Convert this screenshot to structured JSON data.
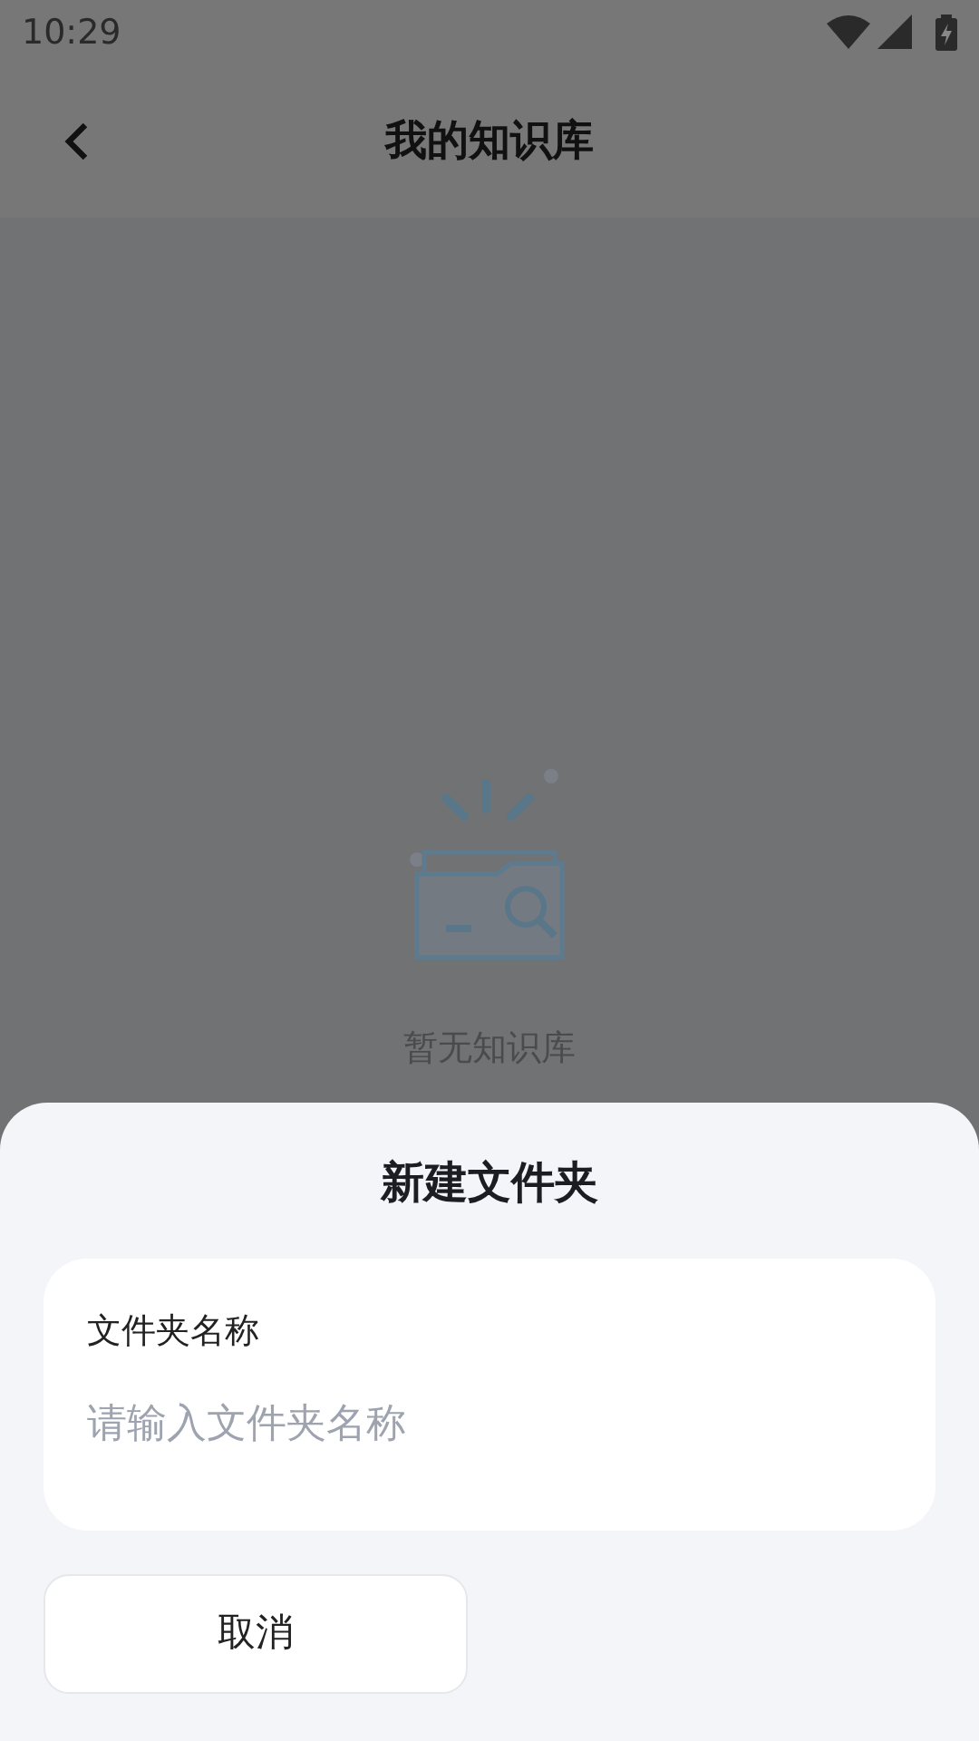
{
  "status_bar": {
    "time": "10:29"
  },
  "header": {
    "title": "我的知识库"
  },
  "empty_state": {
    "text": "暂无知识库"
  },
  "dialog": {
    "title": "新建文件夹",
    "field": {
      "label": "文件夹名称",
      "placeholder": "请输入文件夹名称"
    },
    "buttons": [
      {
        "label": "取消"
      }
    ]
  }
}
